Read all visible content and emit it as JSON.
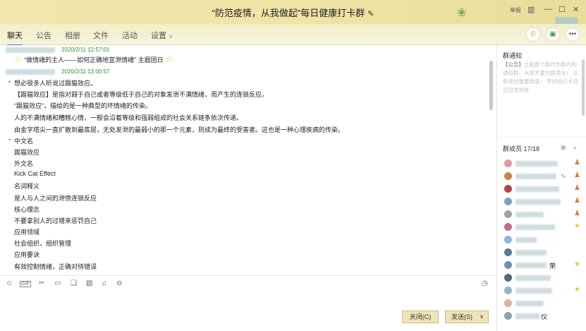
{
  "window": {
    "title": "“防范疫情，从我做起”每日健康打卡群",
    "edit_icon": "✎",
    "skin_label": "举报",
    "controls": {
      "skin": "▥",
      "minimize": "—",
      "maximize": "☐",
      "close": "✕"
    }
  },
  "tabs": [
    "聊天",
    "公告",
    "相册",
    "文件",
    "活动",
    "设置"
  ],
  "header_icons": {
    "phone": "phone-icon",
    "video": "screen-share-icon",
    "more": "more-icon"
  },
  "messages": {
    "ts1": "2020/2/11 12:57:01",
    "system_line": "“做情绪的主人——如何正确地宣泄情绪” 主题团日",
    "ts2": "2020/2/11 13:00:57",
    "lines": [
      "想必很多人听说过踢猫效应。",
      "【踢猫效应】是指对弱于自己或者等级低于自己的对象发泄不满情绪，而产生的连锁反应。",
      "“踢猫效应”，描绘的是一种典型的坏情绪的传染。",
      "人的不满情绪和糟糕心情，一般会沿着等级和强弱组成的社会关系链条依次传递。",
      "由金字塔尖一直扩散到最底层，无处发泄的最弱小的那一个元素，则成为最终的受害者。这也是一种心理疾病的传染。"
    ],
    "list": [
      "中文名",
      "踢猫效应",
      "外文名",
      "Kick Cat Effect",
      "名词释义",
      "是人与人之间的泄愤连锁反应",
      "核心理念",
      "不要拿别人的过错来惩罚自己",
      "应用领域",
      "社会组织，组织管理",
      "应用要诀",
      "有效控制情绪，正确对待错误"
    ]
  },
  "buttons": {
    "close": "关闭(C)",
    "send": "发送(S)",
    "send_arrow": "∨"
  },
  "sidebar": {
    "notice_title": "群通知",
    "notice_tag": "【公告】",
    "notice_text": "之前那个群作为群内的通知群，大家不要在群里水！ 以免错过重要信息！ 平时的打卡自己自觉办账",
    "members_title": "群成员 17/18",
    "member_partial_names": [
      "荣",
      "仪"
    ]
  },
  "colors": {
    "titlebar": "#f1e6ac",
    "timestamp": "#2b8a3a",
    "accent": "#3a7bd5",
    "owner_star": "#f1c232"
  }
}
